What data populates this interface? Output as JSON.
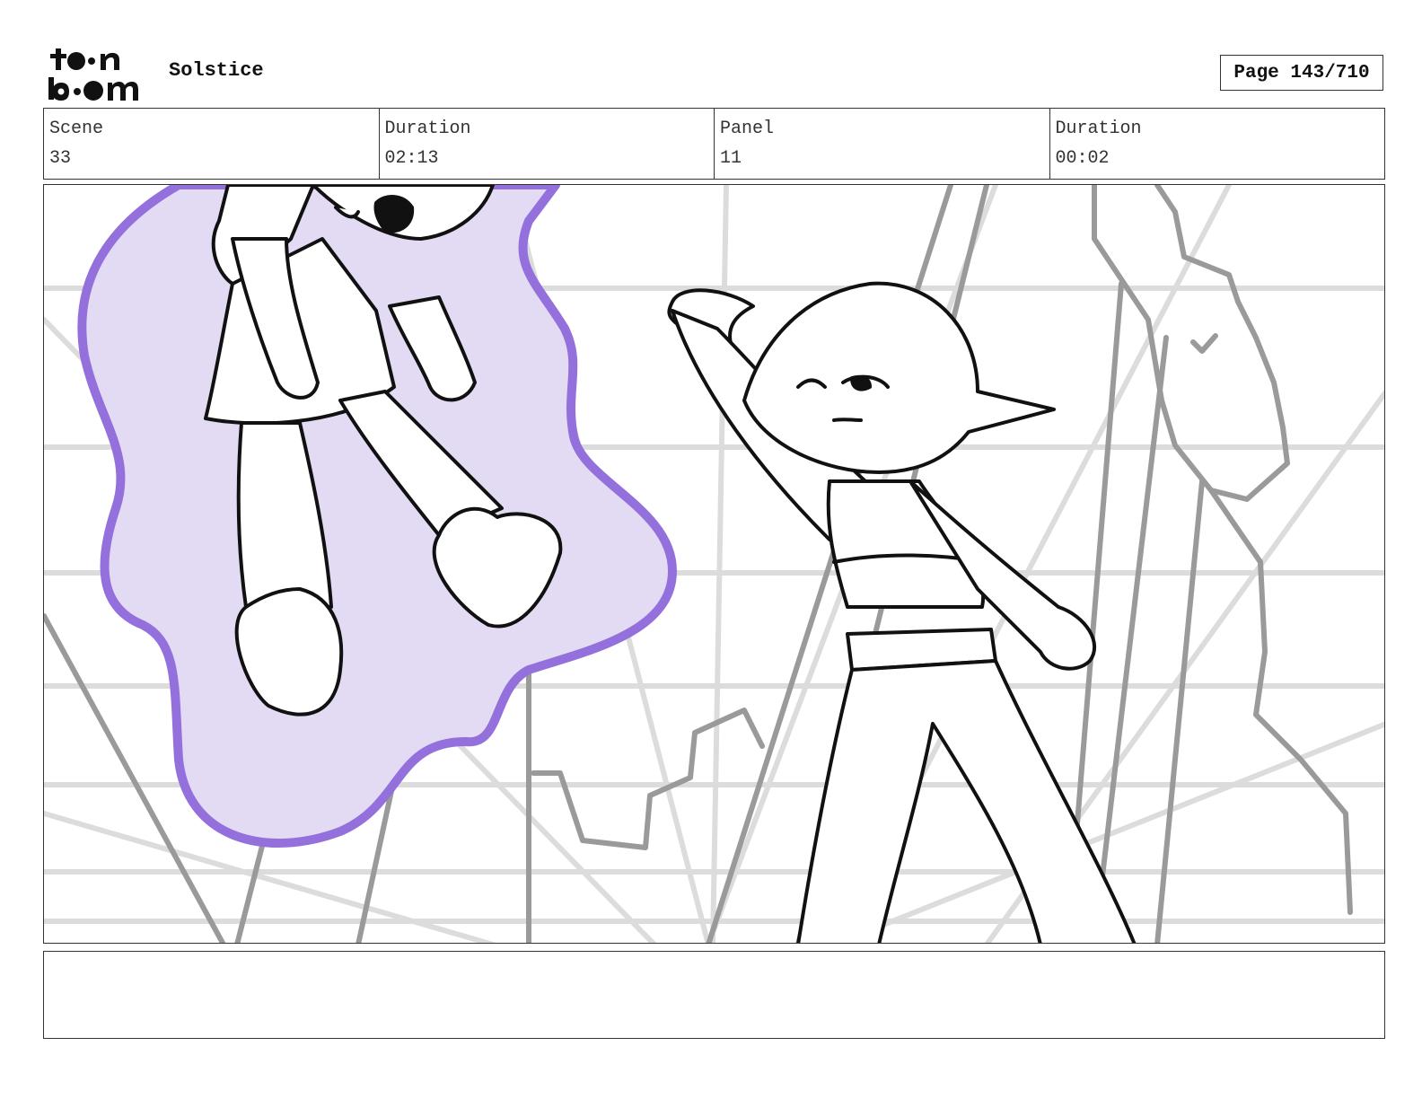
{
  "header": {
    "logo_text": "toon boom",
    "project_title": "Solstice",
    "page_label": "Page 143/710"
  },
  "info": {
    "scene_label": "Scene",
    "scene_value": "33",
    "scene_duration_label": "Duration",
    "scene_duration_value": "02:13",
    "panel_label": "Panel",
    "panel_value": "11",
    "panel_duration_label": "Duration",
    "panel_duration_value": "00:02"
  },
  "colors": {
    "line": "#111111",
    "grid_light": "#dddddd",
    "grid_dark": "#999999",
    "aura_fill": "#e2dbf3",
    "aura_stroke": "#9370db"
  },
  "notes": {
    "text": ""
  }
}
